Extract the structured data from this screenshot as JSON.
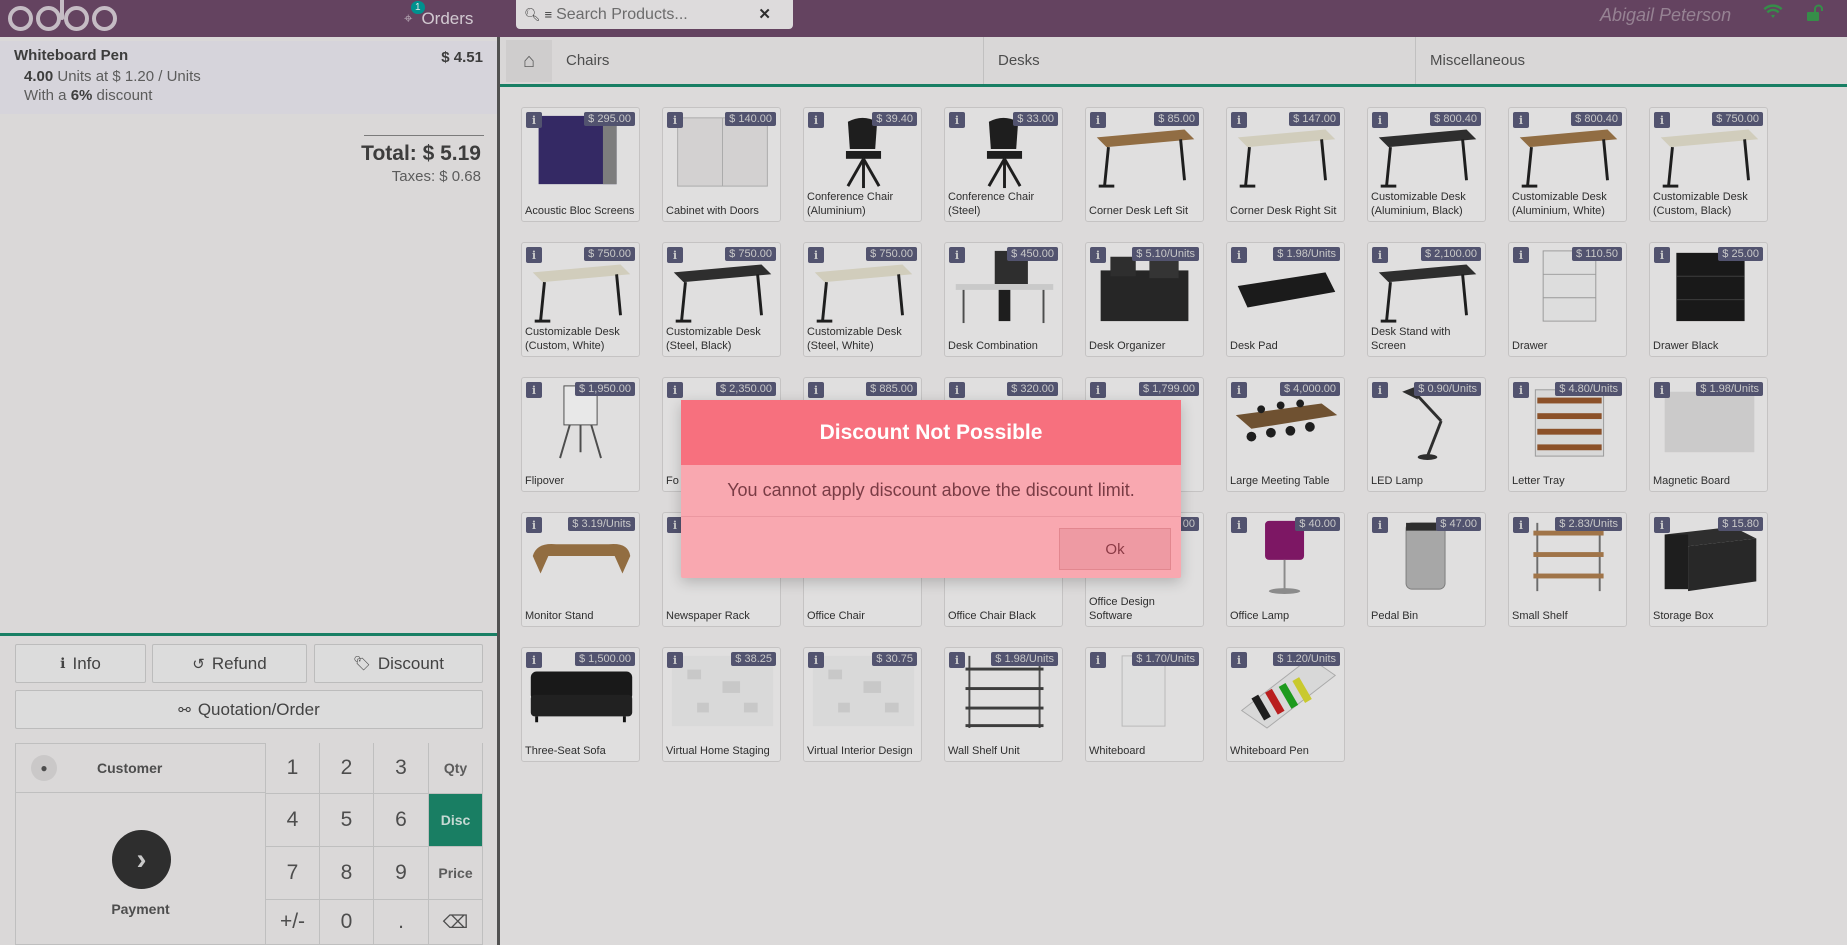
{
  "header": {
    "orders_label": "Orders",
    "orders_badge": "1",
    "search_placeholder": "Search Products...",
    "user_name": "Abigail Peterson"
  },
  "order": {
    "line": {
      "name": "Whiteboard Pen",
      "price": "$ 4.51",
      "qty": "4.00",
      "qty_text": "Units at $ 1.20 / Units",
      "discount_prefix": "With a",
      "discount_value": "6%",
      "discount_suffix": "discount"
    },
    "total": "Total: $ 5.19",
    "taxes": "Taxes: $ 0.68"
  },
  "actions": {
    "info": "Info",
    "refund": "Refund",
    "discount": "Discount",
    "quotation": "Quotation/Order"
  },
  "numpad": {
    "customer": "Customer",
    "payment": "Payment",
    "keys": [
      "1",
      "2",
      "3",
      "4",
      "5",
      "6",
      "7",
      "8",
      "9",
      "+/-",
      "0",
      "."
    ],
    "modes": [
      "Qty",
      "Disc",
      "Price"
    ],
    "active_mode": "Disc"
  },
  "categories": [
    "Chairs",
    "Desks",
    "Miscellaneous"
  ],
  "products": [
    {
      "name": "Acoustic Bloc Screens",
      "price": "$ 295.00",
      "img": "screen"
    },
    {
      "name": "Cabinet with Doors",
      "price": "$ 140.00",
      "img": "cabinet"
    },
    {
      "name": "Conference Chair (Aluminium)",
      "price": "$ 39.40",
      "img": "chair"
    },
    {
      "name": "Conference Chair (Steel)",
      "price": "$ 33.00",
      "img": "chair"
    },
    {
      "name": "Corner Desk Left Sit",
      "price": "$ 85.00",
      "img": "desk-wood"
    },
    {
      "name": "Corner Desk Right Sit",
      "price": "$ 147.00",
      "img": "desk-light"
    },
    {
      "name": "Customizable Desk (Aluminium, Black)",
      "price": "$ 800.40",
      "img": "desk-dark"
    },
    {
      "name": "Customizable Desk (Aluminium, White)",
      "price": "$ 800.40",
      "img": "desk-wood"
    },
    {
      "name": "Customizable Desk (Custom, Black)",
      "price": "$ 750.00",
      "img": "desk-light"
    },
    {
      "name": "Customizable Desk (Custom, White)",
      "price": "$ 750.00",
      "img": "desk-light"
    },
    {
      "name": "Customizable Desk (Steel, Black)",
      "price": "$ 750.00",
      "img": "desk-dark"
    },
    {
      "name": "Customizable Desk (Steel, White)",
      "price": "$ 750.00",
      "img": "desk-light"
    },
    {
      "name": "Desk Combination",
      "price": "$ 450.00",
      "img": "combo"
    },
    {
      "name": "Desk Organizer",
      "price": "$ 5.10/Units",
      "img": "organizer"
    },
    {
      "name": "Desk Pad",
      "price": "$ 1.98/Units",
      "img": "pad"
    },
    {
      "name": "Desk Stand with Screen",
      "price": "$ 2,100.00",
      "img": "desk-dark"
    },
    {
      "name": "Drawer",
      "price": "$ 110.50",
      "img": "drawer"
    },
    {
      "name": "Drawer Black",
      "price": "$ 25.00",
      "img": "drawer-black"
    },
    {
      "name": "Flipover",
      "price": "$ 1,950.00",
      "img": "flip"
    },
    {
      "name": "Fo",
      "price": "$ 2,350.00",
      "img": "blank"
    },
    {
      "name": "",
      "price": "$ 885.00",
      "img": "blank"
    },
    {
      "name": "",
      "price": "$ 320.00",
      "img": "blank"
    },
    {
      "name": "",
      "price": "$ 1,799.00",
      "img": "blank"
    },
    {
      "name": "Large Meeting Table",
      "price": "$ 4,000.00",
      "img": "meeting"
    },
    {
      "name": "LED Lamp",
      "price": "$ 0.90/Units",
      "img": "lamp"
    },
    {
      "name": "Letter Tray",
      "price": "$ 4.80/Units",
      "img": "tray"
    },
    {
      "name": "Magnetic Board",
      "price": "$ 1.98/Units",
      "img": "board"
    },
    {
      "name": "Monitor Stand",
      "price": "$ 3.19/Units",
      "img": "stand"
    },
    {
      "name": "Newspaper Rack",
      "price": "",
      "img": "blank"
    },
    {
      "name": "Office Chair",
      "price": "",
      "img": "blank"
    },
    {
      "name": "Office Chair Black",
      "price": "",
      "img": "blank"
    },
    {
      "name": "Office Design Software",
      "price": "00",
      "img": "blank"
    },
    {
      "name": "Office Lamp",
      "price": "$ 40.00",
      "img": "office-lamp"
    },
    {
      "name": "Pedal Bin",
      "price": "$ 47.00",
      "img": "bin"
    },
    {
      "name": "Small Shelf",
      "price": "$ 2.83/Units",
      "img": "shelf"
    },
    {
      "name": "Storage Box",
      "price": "$ 15.80",
      "img": "box"
    },
    {
      "name": "Three-Seat Sofa",
      "price": "$ 1,500.00",
      "img": "sofa"
    },
    {
      "name": "Virtual Home Staging",
      "price": "$ 38.25",
      "img": "virtual"
    },
    {
      "name": "Virtual Interior Design",
      "price": "$ 30.75",
      "img": "virtual"
    },
    {
      "name": "Wall Shelf Unit",
      "price": "$ 1.98/Units",
      "img": "wallshelf"
    },
    {
      "name": "Whiteboard",
      "price": "$ 1.70/Units",
      "img": "whiteboard"
    },
    {
      "name": "Whiteboard Pen",
      "price": "$ 1.20/Units",
      "img": "pens"
    }
  ],
  "dialog": {
    "title": "Discount Not Possible",
    "body": "You cannot apply discount above the discount limit.",
    "ok": "Ok"
  },
  "colors": {
    "header": "#6e4a6a",
    "accent": "#1c8b6d",
    "dialog_title": "#f7707e",
    "dialog_body": "#f9a8b0"
  }
}
